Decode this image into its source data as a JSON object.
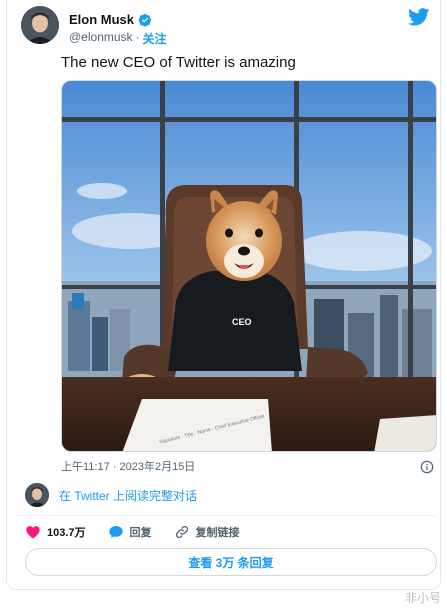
{
  "author": {
    "name": "Elon Musk",
    "handle": "@elonmusk",
    "separator": "·",
    "follow_label": "关注"
  },
  "tweet": {
    "text": "The new CEO of Twitter is amazing",
    "timestamp": "上午11:17 · 2023年2月15日"
  },
  "photo": {
    "sweater_text": "CEO",
    "paper_text": "Signature · Title · Name · Chief Executive Officer"
  },
  "read_link": "在 Twitter 上阅读完整对话",
  "actions": {
    "like_count": "103.7万",
    "reply_label": "回复",
    "copy_link_label": "复制链接"
  },
  "view_replies_label": "查看 3万 条回复",
  "watermark": "非小号",
  "colors": {
    "accent": "#1d9bf0",
    "like": "#f91880"
  },
  "icons": [
    "verified-badge-icon",
    "twitter-bird-icon",
    "info-icon",
    "heart-icon",
    "reply-bubble-icon",
    "link-icon"
  ]
}
